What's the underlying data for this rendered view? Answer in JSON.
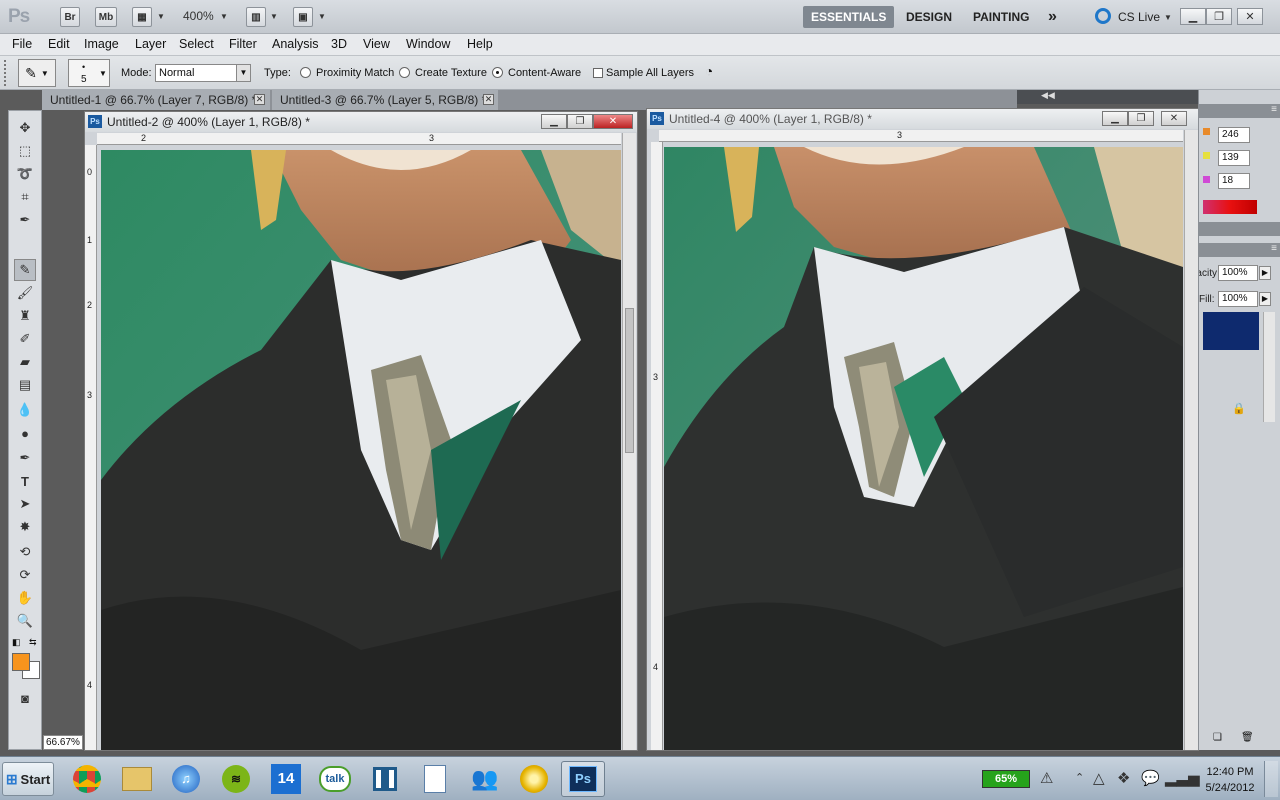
{
  "appbar": {
    "logo": "Ps",
    "br_label": "Br",
    "mb_label": "Mb",
    "zoom": "400%",
    "workspaces": [
      "ESSENTIALS",
      "DESIGN",
      "PAINTING"
    ],
    "more": "»",
    "cs_live": "CS Live"
  },
  "menu": [
    "File",
    "Edit",
    "Image",
    "Layer",
    "Select",
    "Filter",
    "Analysis",
    "3D",
    "View",
    "Window",
    "Help"
  ],
  "options": {
    "brush_size": "5",
    "mode_label": "Mode:",
    "mode_value": "Normal",
    "type_label": "Type:",
    "type_options": [
      "Proximity Match",
      "Create Texture",
      "Content-Aware"
    ],
    "selected_type": "Content-Aware",
    "sample_all_layers": "Sample All Layers"
  },
  "tabs": [
    {
      "label": "Untitled-1 @ 66.7% (Layer 7, RGB/8) *"
    },
    {
      "label": "Untitled-3 @ 66.7% (Layer 5, RGB/8) *"
    }
  ],
  "windows": {
    "left": {
      "title": "Untitled-2 @ 400% (Layer 1, RGB/8) *",
      "ruler_h": [
        "2",
        "3"
      ],
      "ruler_v": [
        "0",
        "1",
        "2",
        "3",
        "4"
      ]
    },
    "right": {
      "title": "Untitled-4 @ 400% (Layer 1, RGB/8) *",
      "ruler_h": [
        "3"
      ],
      "ruler_v": [
        "3",
        "4"
      ]
    }
  },
  "tools": [
    "move-tool",
    "marquee-tool",
    "lasso-tool",
    "crop-tool",
    "eyedropper-tool",
    "spot-healing-tool",
    "brush-tool",
    "clone-stamp-tool",
    "history-brush-tool",
    "eraser-tool",
    "gradient-tool",
    "blur-tool",
    "dodge-tool",
    "pen-tool",
    "type-tool",
    "path-selection-tool",
    "shape-tool",
    "3d-rotate-tool",
    "3d-orbit-tool",
    "hand-tool",
    "zoom-tool"
  ],
  "toolbox": {
    "foreground_color": "#f7941d",
    "background_color": "#ffffff"
  },
  "status": {
    "zoom": "66.67%"
  },
  "panels": {
    "color": {
      "r": "246",
      "g": "139",
      "b": "18"
    },
    "layers": {
      "opacity_label": "Opacity:",
      "opacity": "100%",
      "fill_label": "Fill:",
      "fill": "100%"
    }
  },
  "taskbar": {
    "start": "Start",
    "apps": [
      "chrome-icon",
      "file-explorer-icon",
      "itunes-icon",
      "spotify-icon",
      "calendar-icon",
      "google-talk-icon",
      "trello-icon",
      "notes-icon",
      "contacts-icon",
      "music-player-icon",
      "photoshop-icon"
    ],
    "calendar_day": "14",
    "talk_label": "talk",
    "ps_label": "Ps",
    "battery": "65%",
    "time": "12:40 PM",
    "date": "5/24/2012"
  }
}
